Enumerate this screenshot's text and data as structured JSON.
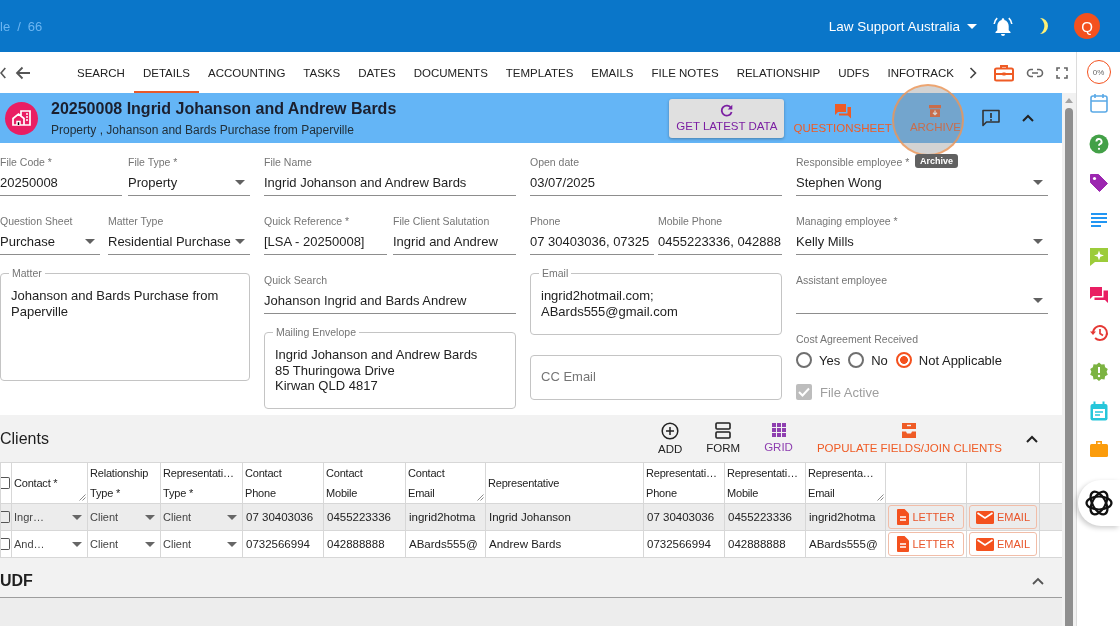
{
  "top_bar": {
    "breadcrumb": {
      "items": [
        "le",
        "66"
      ],
      "separator": "/"
    },
    "organization": "Law Support Australia",
    "avatar": "Q"
  },
  "tabs": [
    {
      "label": "SEARCH",
      "selected": false
    },
    {
      "label": "DETAILS",
      "selected": true
    },
    {
      "label": "ACCOUNTING",
      "selected": false
    },
    {
      "label": "TASKS",
      "selected": false
    },
    {
      "label": "DATES",
      "selected": false
    },
    {
      "label": "DOCUMENTS",
      "selected": false
    },
    {
      "label": "TEMPLATES",
      "selected": false
    },
    {
      "label": "EMAILS",
      "selected": false
    },
    {
      "label": "FILE NOTES",
      "selected": false
    },
    {
      "label": "RELATIONSHIP",
      "selected": false
    },
    {
      "label": "UDFS",
      "selected": false
    },
    {
      "label": "INFOTRACK",
      "selected": false
    }
  ],
  "matter_header": {
    "title": "20250008 Ingrid Johanson and Andrew Bards",
    "subtitle": "Property , Johanson and Bards Purchase from Paperville",
    "actions": [
      {
        "kind": "refresh",
        "label": "GET LATEST DATA"
      },
      {
        "kind": "questionsheet",
        "label": "QUESTIONSHEET"
      },
      {
        "kind": "archive",
        "label": "ARCHIVE"
      }
    ],
    "tooltip": "Archive"
  },
  "form": {
    "columns": [
      {
        "rows": [
          [
            {
              "kind": "text",
              "label": "File Code *",
              "value": "20250008"
            },
            {
              "kind": "select",
              "label": "File Type *",
              "value": "Property"
            }
          ],
          [
            {
              "kind": "select",
              "label": "Question Sheet",
              "value": "Purchase"
            },
            {
              "kind": "select",
              "label": "Matter Type",
              "value": "Residential Purchase"
            }
          ],
          [
            {
              "kind": "textarea",
              "label": "Matter",
              "value": "Johanson and Bards Purchase from Paperville"
            }
          ]
        ]
      },
      {
        "rows": [
          [
            {
              "kind": "text",
              "label": "File Name",
              "value": "Ingrid Johanson and Andrew Bards"
            }
          ],
          [
            {
              "kind": "text",
              "label": "Quick Reference *",
              "value": "[LSA - 20250008]"
            },
            {
              "kind": "text",
              "label": "File Client Salutation",
              "value": "Ingrid and Andrew"
            }
          ],
          [
            {
              "kind": "text",
              "label": "Quick Search",
              "value": "Johanson Ingrid and Bards Andrew"
            }
          ],
          [
            {
              "kind": "textarea",
              "label": "Mailing Envelope",
              "value": "Ingrid Johanson and Andrew Bards\n85 Thuringowa Drive\nKirwan QLD 4817"
            }
          ]
        ]
      },
      {
        "rows": [
          [
            {
              "kind": "text",
              "label": "Open date",
              "value": "03/07/2025"
            }
          ],
          [
            {
              "kind": "text",
              "label": "Phone",
              "value": "07 30403036, 07325"
            },
            {
              "kind": "text",
              "label": "Mobile Phone",
              "value": "0455223336, 042888"
            }
          ],
          [
            {
              "kind": "textarea",
              "label": "Email",
              "value": "ingrid2hotmail.com; ABards555@gmail.com"
            }
          ],
          [
            {
              "kind": "textarea",
              "placeholder": "CC Email"
            }
          ]
        ]
      },
      {
        "rows": [
          [
            {
              "kind": "select",
              "label": "Responsible employee *",
              "value": "Stephen Wong"
            }
          ],
          [
            {
              "kind": "select",
              "label": "Managing employee *",
              "value": "Kelly Mills"
            }
          ],
          [
            {
              "kind": "select",
              "label": "Assistant employee"
            }
          ],
          [
            {
              "kind": "radio",
              "label": "Cost Agreement Received",
              "options": [
                {
                  "label": "Yes",
                  "selected": false
                },
                {
                  "label": "No",
                  "selected": false
                },
                {
                  "label": "Not Applicable",
                  "selected": true
                }
              ]
            }
          ],
          [
            {
              "kind": "checkbox",
              "label": "File Active",
              "checked": true,
              "disabled": true
            }
          ]
        ]
      }
    ]
  },
  "clients": {
    "title": "Clients",
    "expanded": true,
    "toolbar": [
      {
        "kind": "add",
        "label": "ADD",
        "selected": false
      },
      {
        "kind": "form",
        "label": "FORM",
        "selected": false
      },
      {
        "kind": "grid",
        "label": "GRID",
        "selected": true
      },
      {
        "kind": "populate",
        "label": "POPULATE FIELDS/JOIN CLIENTS",
        "selected": false
      }
    ],
    "table": {
      "all_checked": false,
      "columns": [
        {
          "label": "Contact *",
          "resizable": true
        },
        {
          "label": "Relationship\nType *",
          "resizable": false
        },
        {
          "label": "Representati…\nType *",
          "resizable": false
        },
        {
          "label": "Contact\nPhone",
          "resizable": false
        },
        {
          "label": "Contact\nMobile",
          "resizable": false
        },
        {
          "label": "Contact\nEmail",
          "resizable": true
        },
        {
          "label": "Representative",
          "resizable": false
        },
        {
          "label": "Representati…\nPhone",
          "resizable": false
        },
        {
          "label": "Representati…\nMobile",
          "resizable": false
        },
        {
          "label": "Representa…\nEmail",
          "resizable": true
        }
      ],
      "rows": [
        {
          "selected": true,
          "checked": false,
          "cells": [
            {
              "kind": "select",
              "value": "Ingr…"
            },
            {
              "kind": "select",
              "value": "Client"
            },
            {
              "kind": "select",
              "value": "Client"
            },
            {
              "kind": "text",
              "value": "07 30403036"
            },
            {
              "kind": "text",
              "value": "0455223336"
            },
            {
              "kind": "text",
              "value": "ingrid2hotma"
            },
            {
              "kind": "text",
              "value": "Ingrid Johanson"
            },
            {
              "kind": "text",
              "value": "07 30403036"
            },
            {
              "kind": "text",
              "value": "0455223336"
            },
            {
              "kind": "text",
              "value": "ingrid2hotma"
            }
          ],
          "actions": [
            {
              "kind": "letter",
              "label": "LETTER"
            },
            {
              "kind": "email",
              "label": "EMAIL"
            }
          ]
        },
        {
          "selected": false,
          "checked": false,
          "cells": [
            {
              "kind": "select",
              "value": "And…"
            },
            {
              "kind": "select",
              "value": "Client"
            },
            {
              "kind": "select",
              "value": "Client"
            },
            {
              "kind": "text",
              "value": "0732566994"
            },
            {
              "kind": "text",
              "value": "042888888"
            },
            {
              "kind": "text",
              "value": "ABards555@"
            },
            {
              "kind": "text",
              "value": "Andrew Bards"
            },
            {
              "kind": "text",
              "value": "0732566994"
            },
            {
              "kind": "text",
              "value": "042888888"
            },
            {
              "kind": "text",
              "value": "ABards555@"
            }
          ],
          "actions": [
            {
              "kind": "letter",
              "label": "LETTER"
            },
            {
              "kind": "email",
              "label": "EMAIL"
            }
          ]
        }
      ]
    }
  },
  "udf": {
    "title": "UDF",
    "expanded": true
  },
  "sidebar": {
    "progress_label": "0%"
  }
}
